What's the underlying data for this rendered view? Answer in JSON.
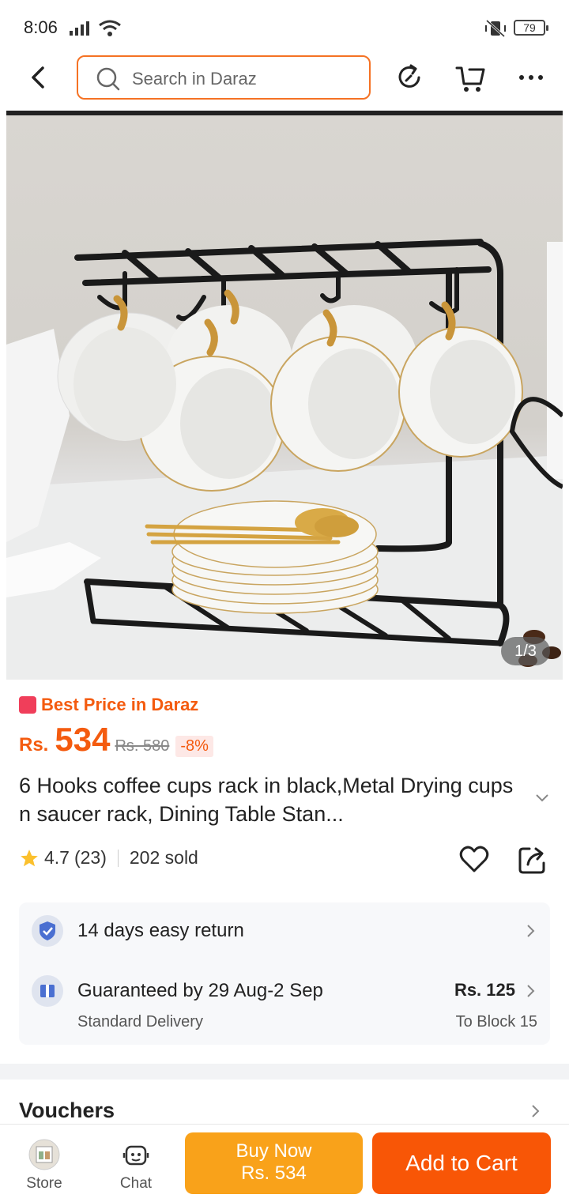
{
  "status_bar": {
    "time": "8:06",
    "battery": "79"
  },
  "header": {
    "search_placeholder": "Search in Daraz"
  },
  "gallery": {
    "counter": "1/3"
  },
  "product": {
    "badge": "Best Price in Daraz",
    "currency": "Rs.",
    "price": "534",
    "original_price": "Rs. 580",
    "discount": "-8%",
    "title": "6 Hooks coffee cups rack in black,Metal Drying cups n saucer rack, Dining Table Stan...",
    "rating": "4.7",
    "reviews": "(23)",
    "sold": "202 sold"
  },
  "services": {
    "return": "14 days easy return",
    "delivery": "Guaranteed by 29 Aug-2 Sep",
    "delivery_type": "Standard Delivery",
    "fee": "Rs. 125",
    "destination": "To Block 15"
  },
  "vouchers": {
    "label": "Vouchers"
  },
  "bottom_bar": {
    "store": "Store",
    "chat": "Chat",
    "buy_now": "Buy Now",
    "buy_price": "Rs. 534",
    "add_to_cart": "Add to Cart"
  },
  "colors": {
    "accent": "#f85606",
    "buy": "#f9a21a",
    "price": "#f45b0f"
  }
}
